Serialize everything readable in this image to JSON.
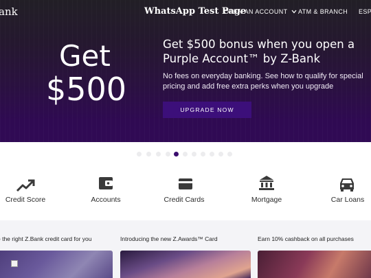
{
  "header": {
    "logo_text": "ank",
    "tab_title": "WhatsApp Test Page",
    "nav": {
      "open_account": "OPEN AN ACCOUNT",
      "atm_branch": "ATM & BRANCH",
      "espanol": "ESPA"
    }
  },
  "hero": {
    "big_line1": "Get",
    "big_line2": "$500",
    "headline": "Get $500 bonus when you open a Purple Account™ by Z-Bank",
    "subtext": "No fees on everyday banking. See how to qualify for special pricing and add free extra perks when you upgrade",
    "cta_label": "UPGRADE NOW"
  },
  "carousel": {
    "total": 11,
    "active_index": 4,
    "active_color": "#3b0d6e",
    "inactive_color": "#ececee"
  },
  "categories": [
    {
      "label": "Credit Score",
      "icon": "trend-up-icon"
    },
    {
      "label": "Accounts",
      "icon": "wallet-icon"
    },
    {
      "label": "Credit Cards",
      "icon": "credit-card-icon"
    },
    {
      "label": "Mortgage",
      "icon": "bank-icon"
    },
    {
      "label": "Car Loans",
      "icon": "car-icon"
    }
  ],
  "cards": [
    {
      "text": "e the right Z.Bank credit card for you"
    },
    {
      "text": "Introducing the new Z.Awards™ Card"
    },
    {
      "text": "Earn 10% cashback on all purchases"
    }
  ],
  "colors": {
    "brand_purple": "#3c0f7a",
    "hero_dark": "#221f26",
    "icon_gray": "#3a3a3a"
  }
}
